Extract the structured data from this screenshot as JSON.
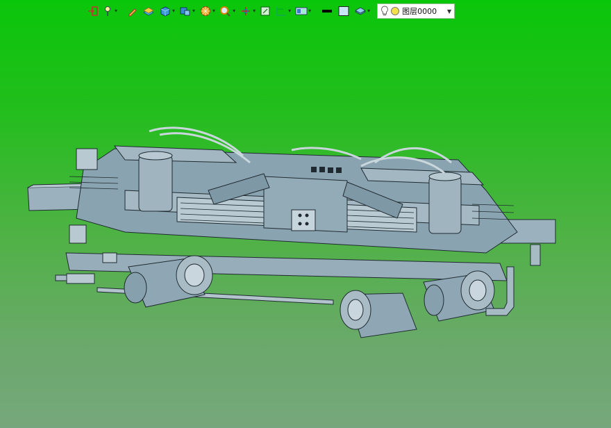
{
  "toolbar": {
    "tools": [
      {
        "name": "exit-icon",
        "has_menu": false
      },
      {
        "name": "bulb-pin-icon",
        "has_menu": true
      },
      {
        "name": "pen-icon",
        "has_menu": false
      },
      {
        "name": "layer-stack-icon",
        "has_menu": false
      },
      {
        "name": "solid-cube-icon",
        "has_menu": true
      },
      {
        "name": "part-icon",
        "has_menu": true
      },
      {
        "name": "render-wheel-icon",
        "has_menu": true
      },
      {
        "name": "zoom-icon",
        "has_menu": true
      },
      {
        "name": "axis-pin-icon",
        "has_menu": true
      },
      {
        "name": "fit-view-icon",
        "has_menu": false
      },
      {
        "name": "section-icon",
        "has_menu": true
      },
      {
        "name": "display-mode-icon",
        "has_menu": true
      },
      {
        "name": "line-color-icon",
        "has_menu": false
      },
      {
        "name": "fill-color-icon",
        "has_menu": false
      },
      {
        "name": "layers-icon",
        "has_menu": true
      }
    ],
    "layer": {
      "value": "图层0000",
      "bulb_color": "#f4e04a"
    }
  },
  "scene": {
    "background_top": "#0ac60a",
    "background_bottom": "#76a77c",
    "model_color": "#8ea6b3",
    "model_edge_color": "#1e2a30"
  }
}
